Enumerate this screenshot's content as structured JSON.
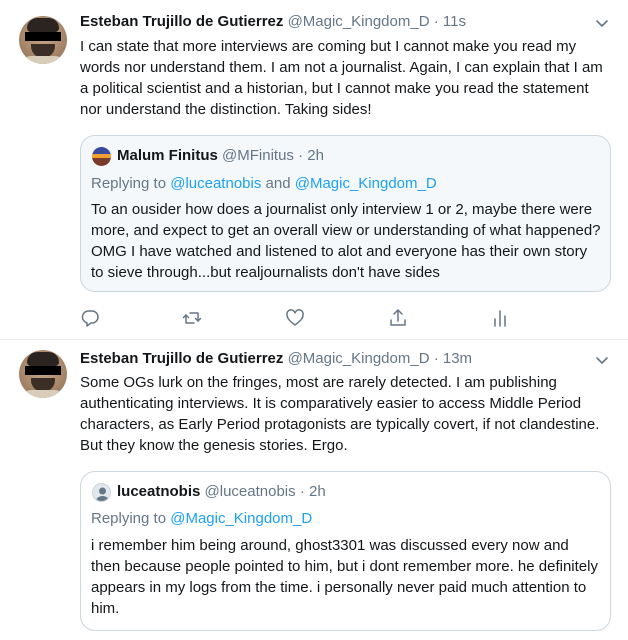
{
  "tweets": [
    {
      "author": {
        "name": "Esteban Trujillo de Gutierrez",
        "handle": "@Magic_Kingdom_D"
      },
      "separator": "·",
      "time": "11s",
      "text": "I can state that more interviews are coming but I cannot make you read my words nor understand them. I am not a journalist. Again, I can explain that I am a political scientist and a historian, but I cannot make you read the statement nor understand the distinction. Taking sides!",
      "quote": {
        "name": "Malum Finitus",
        "handle": "@MFinitus",
        "time": "2h",
        "replying_label": "Replying to",
        "replying_to_1": "@luceatnobis",
        "replying_and": "and",
        "replying_to_2": "@Magic_Kingdom_D",
        "text": "To an ousider how does a journalist only interview 1 or 2, maybe there were more, and expect to get an overall view or understanding of what happened? OMG I have watched and listened to alot and everyone has their own story to sieve through...but realjournalists don't have sides"
      },
      "actions": [
        "reply-icon",
        "retweet-icon",
        "like-icon",
        "share-icon",
        "analytics-icon"
      ]
    },
    {
      "author": {
        "name": "Esteban Trujillo de Gutierrez",
        "handle": "@Magic_Kingdom_D"
      },
      "separator": "·",
      "time": "13m",
      "text": "Some OGs lurk on the fringes, most are rarely detected. I am publishing authenticating interviews. It is comparatively easier to access Middle Period characters, as Early Period protagonists are typically covert, if not clandestine. But they know the genesis stories. Ergo.",
      "quote": {
        "name": "luceatnobis",
        "handle": "@luceatnobis",
        "time": "2h",
        "replying_label": "Replying to",
        "replying_to_1": "@Magic_Kingdom_D",
        "text": "i remember him being around, ghost3301 was discussed every now and then because people pointed to him, but i dont remember more. he definitely appears in my logs from the time. i personally never paid much attention to him."
      }
    }
  ],
  "colors": {
    "link": "#1da1f2",
    "muted": "#657786",
    "border": "#ccd6dd",
    "text": "#14171a"
  }
}
